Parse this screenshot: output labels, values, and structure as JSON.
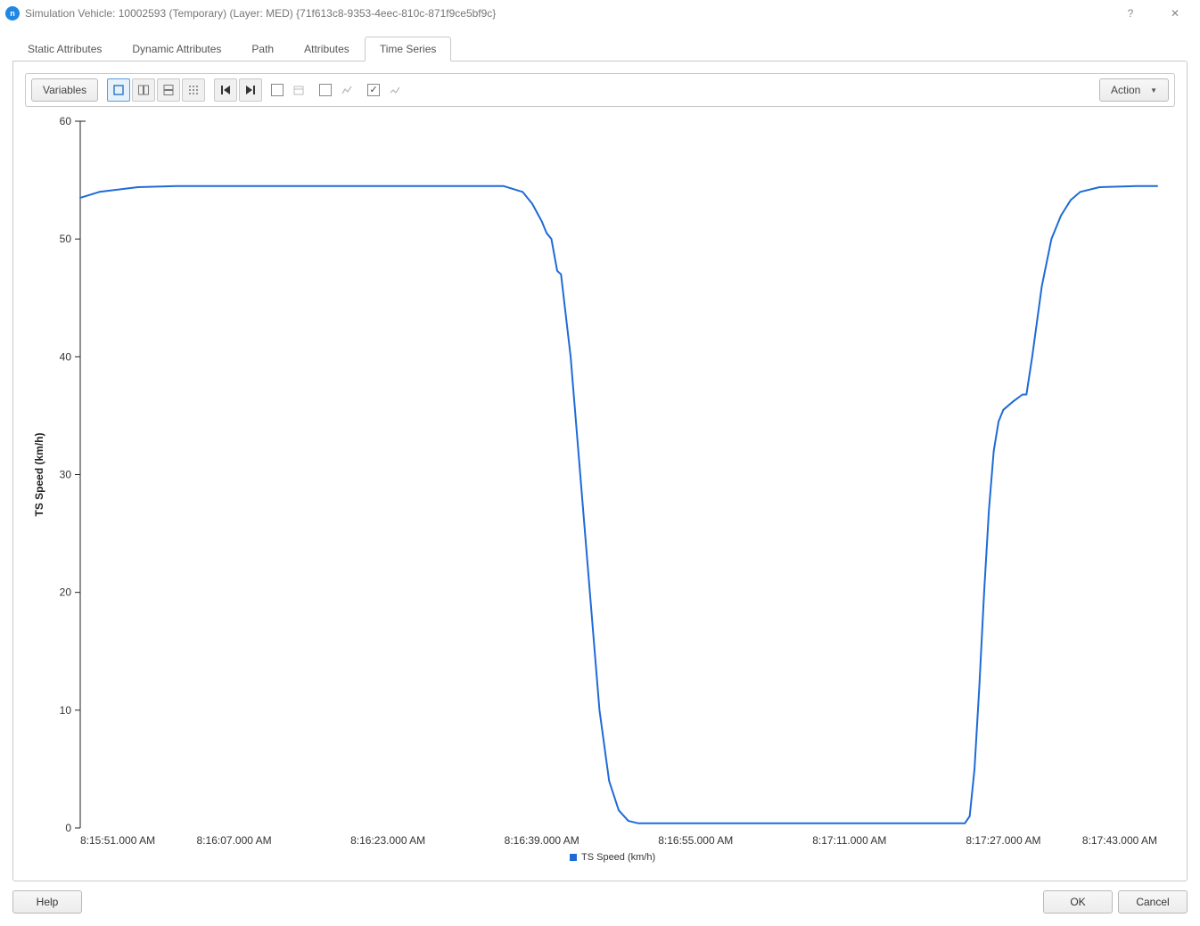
{
  "window_title": "Simulation Vehicle: 10002593 (Temporary) (Layer: MED) {71f613c8-9353-4eec-810c-871f9ce5bf9c}",
  "titlebar_help_symbol": "?",
  "titlebar_close_symbol": "✕",
  "tabs": {
    "items": [
      "Static Attributes",
      "Dynamic Attributes",
      "Path",
      "Attributes",
      "Time Series"
    ],
    "active_index": 4
  },
  "toolbar": {
    "variables_label": "Variables",
    "action_label": "Action",
    "checkbox_checked_index": 2
  },
  "footer": {
    "help_label": "Help",
    "ok_label": "OK",
    "cancel_label": "Cancel"
  },
  "chart_data": {
    "type": "line",
    "ylabel": "TS Speed (km/h)",
    "ylim": [
      0,
      60
    ],
    "y_ticks": [
      0,
      10,
      20,
      30,
      40,
      50,
      60
    ],
    "x_ticks": [
      "8:15:51.000 AM",
      "8:16:07.000 AM",
      "8:16:23.000 AM",
      "8:16:39.000 AM",
      "8:16:55.000 AM",
      "8:17:11.000 AM",
      "8:17:27.000 AM",
      "8:17:43.000 AM"
    ],
    "x_tick_values": [
      0,
      16,
      32,
      48,
      64,
      80,
      96,
      112
    ],
    "legend": "TS Speed (km/h)",
    "series": [
      {
        "name": "TS Speed (km/h)",
        "color": "#1e6bd6",
        "points": [
          [
            0,
            53.5
          ],
          [
            2,
            54.0
          ],
          [
            6,
            54.4
          ],
          [
            10,
            54.5
          ],
          [
            20,
            54.5
          ],
          [
            30,
            54.5
          ],
          [
            40,
            54.5
          ],
          [
            44,
            54.5
          ],
          [
            46,
            54.0
          ],
          [
            47,
            53.0
          ],
          [
            48,
            51.5
          ],
          [
            48.5,
            50.5
          ],
          [
            49,
            50.0
          ],
          [
            49.6,
            47.3
          ],
          [
            50,
            47.0
          ],
          [
            51,
            40.0
          ],
          [
            52,
            30.0
          ],
          [
            53,
            20.0
          ],
          [
            54,
            10.0
          ],
          [
            55,
            4.0
          ],
          [
            56,
            1.5
          ],
          [
            57,
            0.6
          ],
          [
            58,
            0.4
          ],
          [
            64,
            0.4
          ],
          [
            72,
            0.4
          ],
          [
            80,
            0.4
          ],
          [
            88,
            0.4
          ],
          [
            92,
            0.4
          ],
          [
            92.5,
            1.0
          ],
          [
            93,
            5.0
          ],
          [
            93.5,
            12.0
          ],
          [
            94,
            20.0
          ],
          [
            94.5,
            27.0
          ],
          [
            95,
            32.0
          ],
          [
            95.5,
            34.5
          ],
          [
            96,
            35.5
          ],
          [
            97,
            36.2
          ],
          [
            98,
            36.8
          ],
          [
            98.4,
            36.8
          ],
          [
            99,
            40.0
          ],
          [
            100,
            46.0
          ],
          [
            101,
            50.0
          ],
          [
            102,
            52.0
          ],
          [
            103,
            53.3
          ],
          [
            104,
            54.0
          ],
          [
            106,
            54.4
          ],
          [
            110,
            54.5
          ],
          [
            112,
            54.5
          ]
        ]
      }
    ]
  }
}
